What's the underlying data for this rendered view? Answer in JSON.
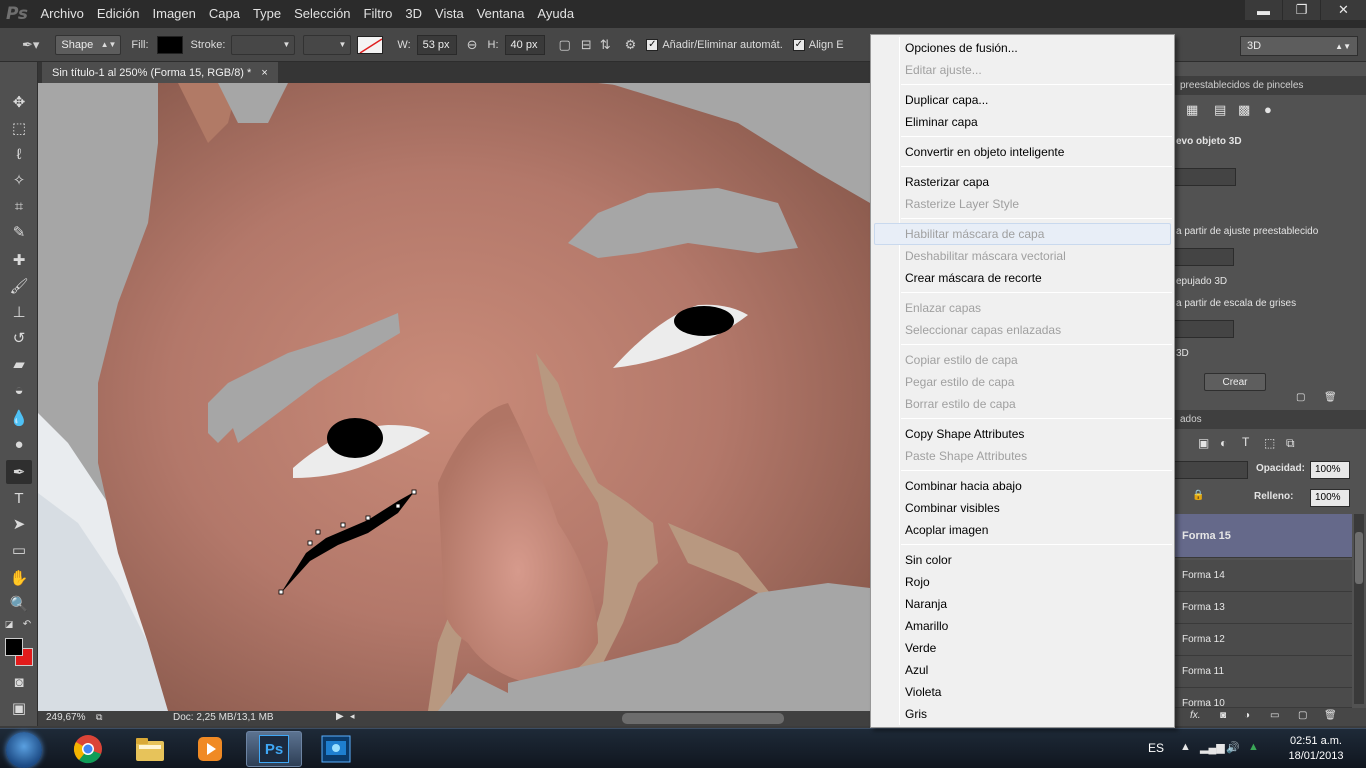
{
  "app": {
    "logo": "Ps"
  },
  "menubar": {
    "items": [
      "Archivo",
      "Edición",
      "Imagen",
      "Capa",
      "Type",
      "Selección",
      "Filtro",
      "3D",
      "Vista",
      "Ventana",
      "Ayuda"
    ]
  },
  "window_controls": {
    "minimize": "▬",
    "restore": "❐",
    "close": "✕"
  },
  "options_bar": {
    "shape_mode": "Shape",
    "fill_label": "Fill:",
    "stroke_label": "Stroke:",
    "width_label": "W:",
    "width_value": "53 px",
    "height_label": "H:",
    "height_value": "40 px",
    "auto_add_delete_label": "Añadir/Eliminar automát.",
    "align_edges_label": "Align E",
    "workspace": "3D"
  },
  "document": {
    "tab_title": "Sin título-1 al 250% (Forma 15, RGB/8) *",
    "tab_close": "×",
    "zoom": "249,67%",
    "doc_info": "Doc: 2,25 MB/13,1 MB"
  },
  "panel_3d": {
    "header": "preestablecidos de pinceles",
    "new_object_label": "evo objeto 3D",
    "option_preset": "a partir de ajuste preestablecido",
    "option_extrusion": "epujado 3D",
    "option_grayscale": "a partir de escala de grises",
    "option_3d": "3D",
    "create_button": "Crear"
  },
  "layers_panel": {
    "header": "ados",
    "opacity_label": "Opacidad:",
    "opacity_value": "100%",
    "fill_label": "Relleno:",
    "fill_value": "100%",
    "layers": [
      "Forma 15",
      "Forma 14",
      "Forma 13",
      "Forma 12",
      "Forma 11",
      "Forma 10"
    ],
    "fx_label": "fx."
  },
  "context_menu": {
    "items": [
      {
        "label": "Opciones de fusión...",
        "enabled": true
      },
      {
        "label": "Editar ajuste...",
        "enabled": false
      },
      {
        "label": "Duplicar capa...",
        "enabled": true
      },
      {
        "label": "Eliminar capa",
        "enabled": true
      },
      {
        "label": "Convertir en objeto inteligente",
        "enabled": true
      },
      {
        "label": "Rasterizar capa",
        "enabled": true
      },
      {
        "label": "Rasterize Layer Style",
        "enabled": false
      },
      {
        "label": "Habilitar máscara de capa",
        "enabled": false
      },
      {
        "label": "Deshabilitar máscara vectorial",
        "enabled": false
      },
      {
        "label": "Crear máscara de recorte",
        "enabled": true
      },
      {
        "label": "Enlazar capas",
        "enabled": false
      },
      {
        "label": "Seleccionar capas enlazadas",
        "enabled": false
      },
      {
        "label": "Copiar estilo de capa",
        "enabled": false
      },
      {
        "label": "Pegar estilo de capa",
        "enabled": false
      },
      {
        "label": "Borrar estilo de capa",
        "enabled": false
      },
      {
        "label": "Copy Shape Attributes",
        "enabled": true
      },
      {
        "label": "Paste Shape Attributes",
        "enabled": false
      },
      {
        "label": "Combinar hacia abajo",
        "enabled": true
      },
      {
        "label": "Combinar visibles",
        "enabled": true
      },
      {
        "label": "Acoplar imagen",
        "enabled": true
      },
      {
        "label": "Sin color",
        "enabled": true
      },
      {
        "label": "Rojo",
        "enabled": true
      },
      {
        "label": "Naranja",
        "enabled": true
      },
      {
        "label": "Amarillo",
        "enabled": true
      },
      {
        "label": "Verde",
        "enabled": true
      },
      {
        "label": "Azul",
        "enabled": true
      },
      {
        "label": "Violeta",
        "enabled": true
      },
      {
        "label": "Gris",
        "enabled": true
      }
    ]
  },
  "taskbar": {
    "language": "ES",
    "time": "02:51 a.m.",
    "date": "18/01/2013",
    "apps": [
      "chrome-icon",
      "explorer-icon",
      "media-player-icon",
      "photoshop-icon",
      "screen-capture-icon"
    ],
    "photoshop_label": "Ps"
  },
  "colors": {
    "foreground": "#000000",
    "background": "#e21b1b",
    "selected_layer": "#65698a",
    "canvas_gray": "#a6a6a6"
  }
}
